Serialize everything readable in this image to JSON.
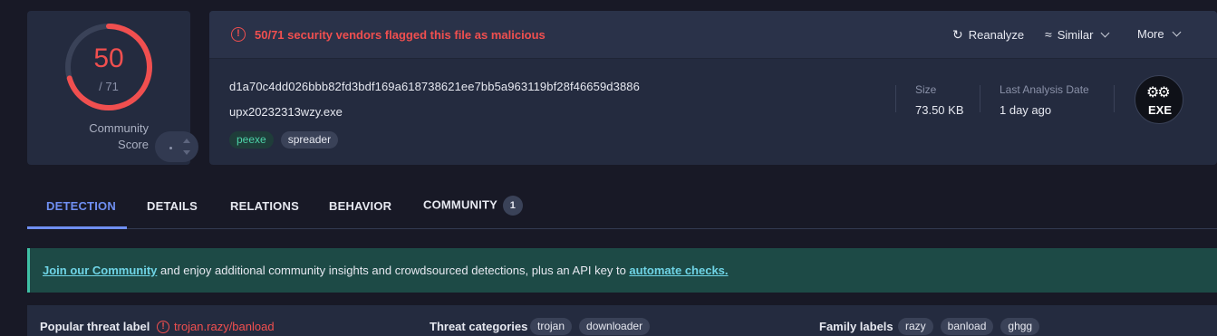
{
  "score": {
    "value": "50",
    "total": "/ 71",
    "detected": 50,
    "max": 71,
    "color": "#f04f4f",
    "community_label_1": "Community",
    "community_label_2": "Score"
  },
  "alert": {
    "text": "50/71 security vendors flagged this file as malicious",
    "color": "#f04f4f"
  },
  "actions": {
    "reanalyze": "Reanalyze",
    "similar": "Similar",
    "more": "More"
  },
  "file": {
    "hash": "d1a70c4dd026bbb82fd3bdf169a618738621ee7bb5a963119bf28f46659d3886",
    "name": "upx20232313wzy.exe",
    "tags": [
      "peexe",
      "spreader"
    ]
  },
  "meta": {
    "size_label": "Size",
    "size_value": "73.50 KB",
    "analysis_label": "Last Analysis Date",
    "analysis_value": "1 day ago"
  },
  "file_type_badge": "EXE",
  "tabs": [
    {
      "label": "DETECTION"
    },
    {
      "label": "DETAILS"
    },
    {
      "label": "RELATIONS"
    },
    {
      "label": "BEHAVIOR"
    },
    {
      "label": "COMMUNITY",
      "count": "1"
    }
  ],
  "banner": {
    "link1": "Join our Community",
    "middle": " and enjoy additional community insights and crowdsourced detections, plus an API key to ",
    "link2": "automate checks."
  },
  "threat": {
    "popular_label": "Popular threat label",
    "popular_value": "trojan.razy/banload",
    "categories_label": "Threat categories",
    "categories": [
      "trojan",
      "downloader"
    ],
    "family_label": "Family labels",
    "families": [
      "razy",
      "banload",
      "ghgg"
    ]
  },
  "colors": {
    "accent": "#6f8ff2",
    "danger": "#f04f4f",
    "background": "#181926",
    "card": "#242b3f"
  }
}
